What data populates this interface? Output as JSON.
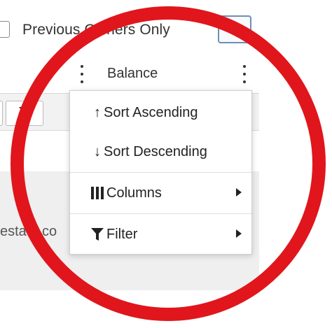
{
  "toolbar": {
    "checkbox_label": "Previous Owners Only",
    "settings_icon": "gear-icon"
  },
  "grid": {
    "column_header": "Balance",
    "cell_text": "estate.co",
    "filter_icon": "funnel-icon"
  },
  "context_menu": {
    "items": [
      {
        "label": "Sort Ascending",
        "icon": "arrow-up-icon",
        "arrow_glyph": "↑"
      },
      {
        "label": "Sort Descending",
        "icon": "arrow-down-icon",
        "arrow_glyph": "↓"
      },
      {
        "label": "Columns",
        "icon": "columns-icon",
        "has_submenu": true
      },
      {
        "label": "Filter",
        "icon": "funnel-icon",
        "has_submenu": true
      }
    ]
  },
  "annotation": {
    "shape": "circle",
    "color": "#e0161c"
  },
  "colors": {
    "settings_border": "#6d8fb8",
    "menu_text": "#222222"
  }
}
